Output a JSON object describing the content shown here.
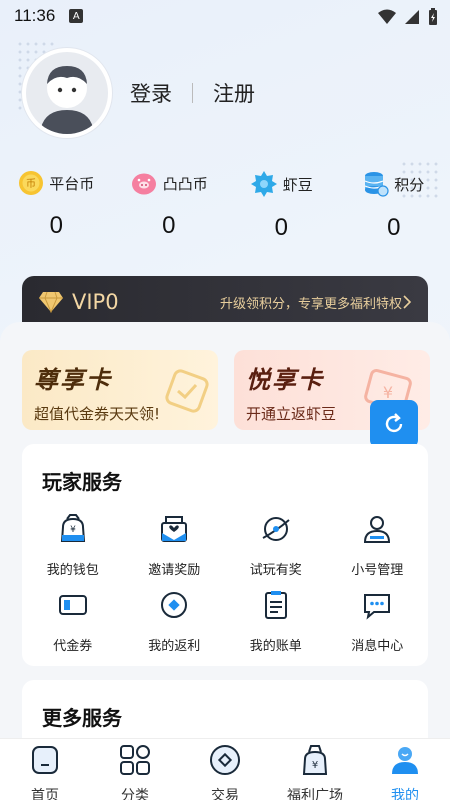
{
  "status": {
    "time": "11:36",
    "a_icon": "A"
  },
  "auth": {
    "login": "登录",
    "register": "注册"
  },
  "assets": [
    {
      "label": "平台币",
      "value": "0",
      "icon": "coin-icon"
    },
    {
      "label": "凸凸币",
      "value": "0",
      "icon": "pig-icon"
    },
    {
      "label": "虾豆",
      "value": "0",
      "icon": "shrimp-bean-icon"
    },
    {
      "label": "积分",
      "value": "0",
      "icon": "points-icon"
    }
  ],
  "vip": {
    "level": "VIP0",
    "promo": "升级领积分，专享更多福利特权"
  },
  "cards": [
    {
      "title": "尊享卡",
      "subtitle": "超值代金券天天领!"
    },
    {
      "title": "悦享卡",
      "subtitle": "开通立返虾豆"
    }
  ],
  "player_services": {
    "title": "玩家服务",
    "items": [
      {
        "label": "我的钱包"
      },
      {
        "label": "邀请奖励"
      },
      {
        "label": "试玩有奖"
      },
      {
        "label": "小号管理"
      },
      {
        "label": "代金券"
      },
      {
        "label": "我的返利"
      },
      {
        "label": "我的账单"
      },
      {
        "label": "消息中心"
      }
    ]
  },
  "more_services": {
    "title": "更多服务"
  },
  "tabs": [
    {
      "label": "首页"
    },
    {
      "label": "分类"
    },
    {
      "label": "交易"
    },
    {
      "label": "福利广场"
    },
    {
      "label": "我的"
    }
  ],
  "colors": {
    "accent": "#1f8ff0",
    "vip_gold": "#f3d7a4"
  }
}
